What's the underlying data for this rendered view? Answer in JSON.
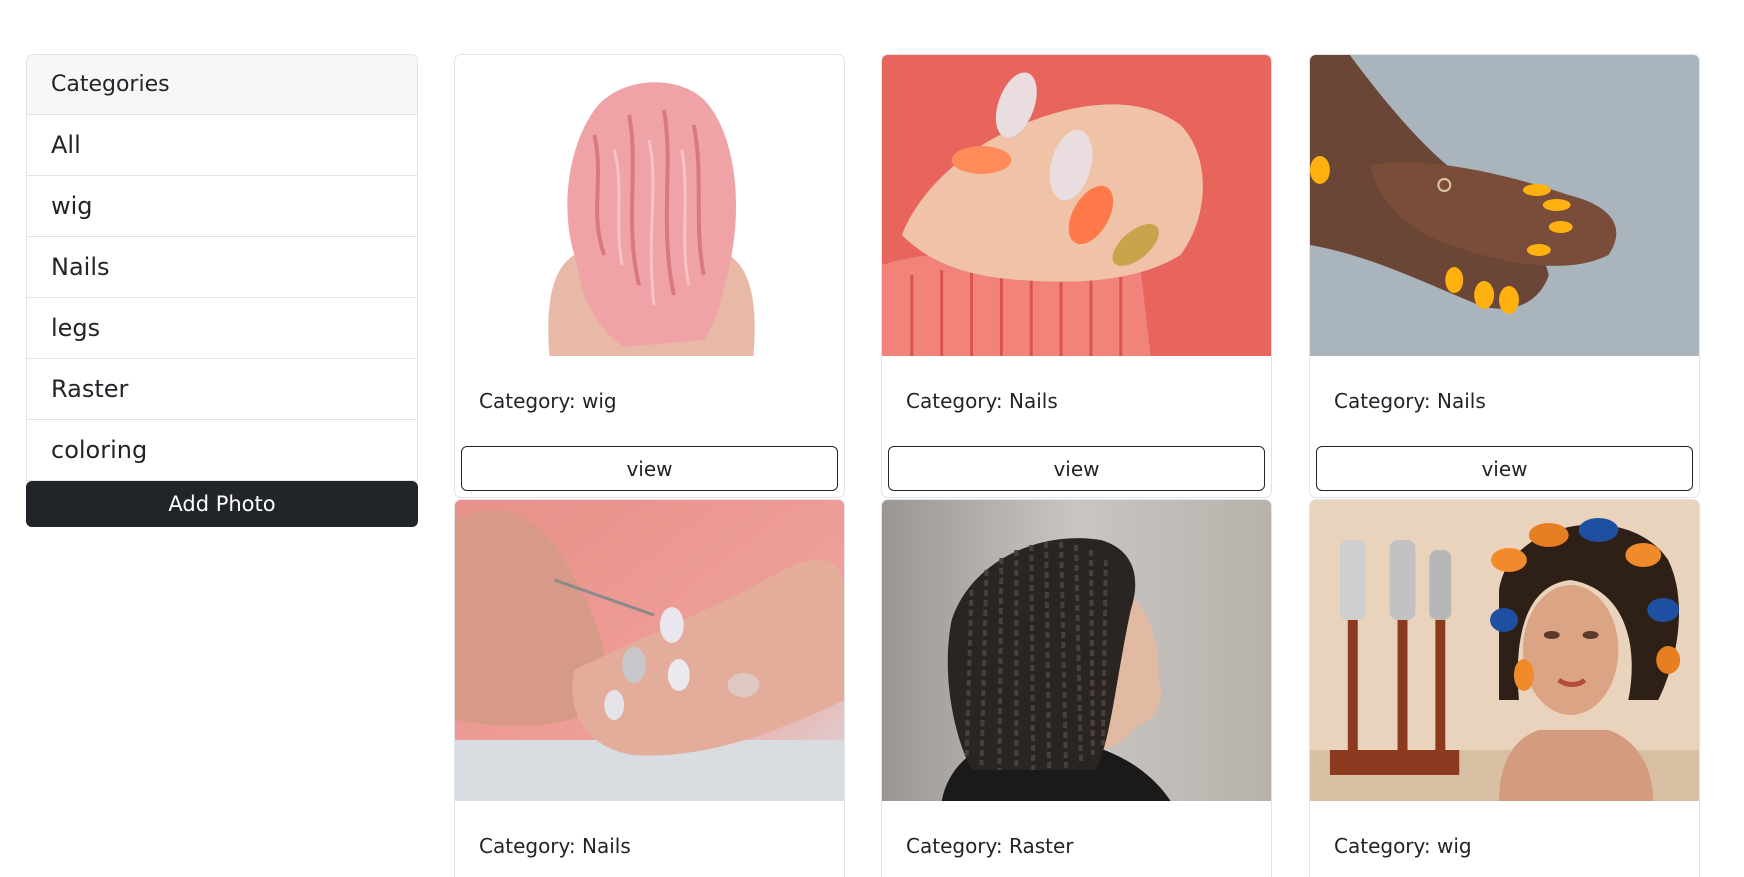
{
  "sidebar": {
    "header": "Categories",
    "items": [
      "All",
      "wig",
      "Nails",
      "legs",
      "Raster",
      "coloring"
    ],
    "add_button": "Add Photo"
  },
  "gallery": {
    "cards": [
      {
        "category": "Category: wig",
        "button": "view",
        "image": "pink-wavy-wig"
      },
      {
        "category": "Category: Nails",
        "button": "view",
        "image": "coral-gold-nails"
      },
      {
        "category": "Category: Nails",
        "button": "view",
        "image": "yellow-nails-hands"
      },
      {
        "category": "Category: Nails",
        "button": "",
        "image": "manicure-in-progress"
      },
      {
        "category": "Category: Raster",
        "button": "",
        "image": "box-braids"
      },
      {
        "category": "Category: wig",
        "button": "",
        "image": "mannequin-curlers"
      }
    ]
  },
  "colors": {
    "dark_button": "#212529",
    "border": "#dfe2e6",
    "header_bg": "#f7f7f7"
  }
}
